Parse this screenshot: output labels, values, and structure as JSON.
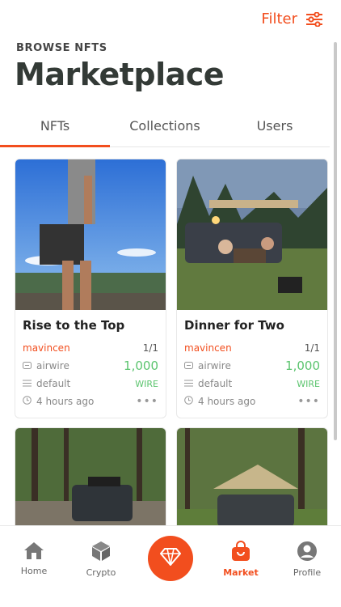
{
  "header": {
    "filter_label": "Filter",
    "subtitle": "BROWSE NFTS",
    "title": "Marketplace"
  },
  "tabs": [
    {
      "label": "NFTs",
      "active": true
    },
    {
      "label": "Collections",
      "active": false
    },
    {
      "label": "Users",
      "active": false
    }
  ],
  "cards": [
    {
      "title": "Rise to the Top",
      "creator": "mavincen",
      "edition": "1/1",
      "chain": "airwire",
      "price": "1,000",
      "collection": "default",
      "currency": "WIRE",
      "time": "4 hours ago"
    },
    {
      "title": "Dinner for Two",
      "creator": "mavincen",
      "edition": "1/1",
      "chain": "airwire",
      "price": "1,000",
      "collection": "default",
      "currency": "WIRE",
      "time": "4 hours ago"
    }
  ],
  "bottom_nav": [
    {
      "label": "Home",
      "icon": "home-icon"
    },
    {
      "label": "Crypto",
      "icon": "cube-icon"
    },
    {
      "label": "",
      "icon": "diamond-icon"
    },
    {
      "label": "Market",
      "icon": "shopping-bag-icon",
      "active": true
    },
    {
      "label": "Profile",
      "icon": "user-icon"
    }
  ],
  "colors": {
    "accent": "#f24e1e",
    "price": "#5bc46e",
    "title": "#333a36"
  }
}
